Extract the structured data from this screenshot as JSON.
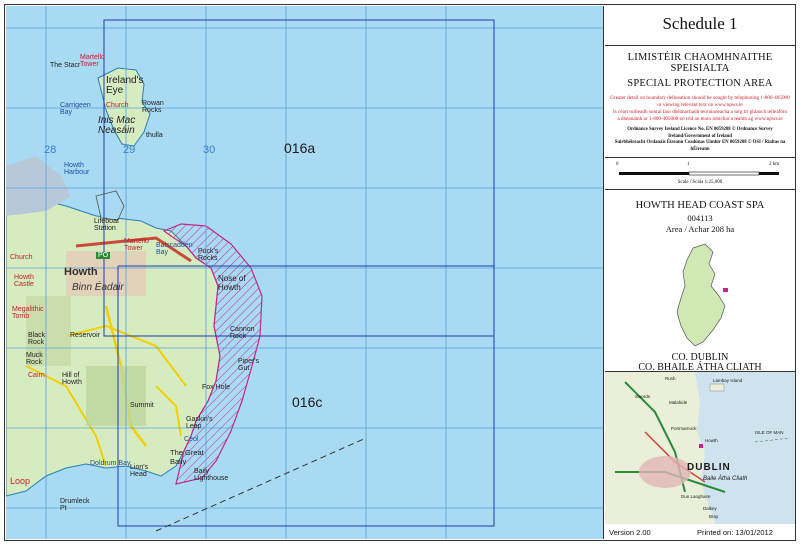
{
  "map": {
    "grid_numbers": [
      "28",
      "29",
      "30"
    ],
    "sheet_labels": [
      "016a",
      "016c"
    ],
    "places": {
      "the_stacr": "The Stacr",
      "martello_tower_n": "Martello\nTower",
      "irelands_eye": "Ireland's\nEye",
      "church": "Church",
      "carrigeen_bay": "Carrigeen\nBay",
      "rowan_rocks": "Rowan\nRocks",
      "inis_mac_neasain": "Inis Mac\nNeasáin",
      "thulla": "thulla",
      "howth_harbour": "Howth\nHarbour",
      "lifeboat_station": "Lifeboat\nStation",
      "martello_tower": "Martello\nTower",
      "balscadden_bay": "Balscadden\nBay",
      "puck_rocks": "Puck's\nRocks",
      "nose_of_howth": "Nose of\nHowth",
      "howth": "Howth",
      "binn_eadair": "Binn Éadair",
      "church_w": "Church",
      "howth_castle": "Howth\nCastle",
      "megalithic_tomb": "Megalithic\nTomb",
      "reservoir": "Reservoir",
      "cannon_rock": "Cannon\nRock",
      "black_rock": "Black\nRock",
      "muck_rock": "Muck\nRock",
      "carn": "Cairn",
      "hill_of_howth": "Hill of\nHowth",
      "pipers_gut": "Piper's\nGut",
      "fox_hole": "Fox Hole",
      "summit": "Summit",
      "gaskins_leap": "Gaskin's\nLeap",
      "ceol": "Ceol",
      "lions_head": "Lion's\nHead",
      "doldrum_bay": "Doldrum Bay",
      "the_great_baily": "The Great\nBaily",
      "baily_lighthouse": "Baily\nLighthouse",
      "drumleck": "Drumleck\nPt",
      "loop": "Loop",
      "po": "PO"
    }
  },
  "panel": {
    "schedule": "Schedule 1",
    "irish_title_1": "LIMISTÉIR CHAOMHNAITHE",
    "irish_title_2": "SPEISIALTA",
    "english_title": "SPECIAL PROTECTION AREA",
    "red_note_1": "Greater detail on boundary delineation should be sought by telephoning 1-800-405000",
    "red_note_2": "or viewing relevant text on www.npws.ie",
    "red_note_3": "Is ceart tuilleadh sonraí faoi dhéanachadh teorainneacha a lorg trí ghlaoch teileafóin",
    "red_note_4": "a dhéanamh ar 1-800-405000 nó tríd an téacs iomchuí a léamh ag www.npws.ie",
    "licence_1": "Ordnance Survey Ireland Licence No. EN 0059208 © Ordnance Survey Ireland/Government of Ireland",
    "licence_2": "Suirbhéireacht Ordanáis Éireann Ceadúnas Uimhir EN 0059208 © OSI / Rialtas na hÉireann",
    "scale_ticks": [
      "0",
      "1",
      "2 km"
    ],
    "scale_label": "Scale / Scála 1:25,000",
    "spa_name": "HOWTH HEAD COAST SPA",
    "spa_code": "004113",
    "area": "Area / Achar 208 ha",
    "county_1": "CO. DUBLIN",
    "county_2": "CO. BHAILE ÁTHA CLIATH",
    "inset_places": {
      "dublin": "DUBLIN",
      "baile_atha_cliath": "Baile Átha Cliath",
      "lambay": "Lambay Island",
      "isle_of_man": "ISLE OF MAN",
      "portmarnock": "Portmarnock",
      "howth": "Howth",
      "dun_laoghaire": "Dun Laoghaire",
      "malahide": "Malahide",
      "swords": "Swords",
      "rush": "Rush",
      "dalkey": "Dalkey",
      "bray": "Bray"
    },
    "version": "Version 2.00",
    "printed": "Printed on: 13/01/2012"
  },
  "colors": {
    "sea": "#a9daf3",
    "land": "#cfe8b4",
    "spa_hatch": "#c2288a",
    "grid": "#3a7bd5",
    "sheet_boundary": "#1f3ca6"
  }
}
